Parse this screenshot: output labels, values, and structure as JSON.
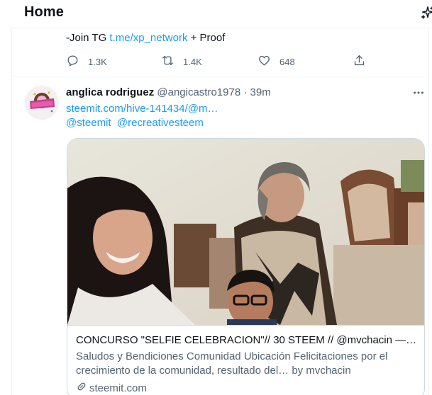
{
  "header": {
    "title": "Home",
    "sparkle_icon": "sparkle-icon"
  },
  "tweet1": {
    "text_prefix": "-Join TG ",
    "link": "t.me/xp_network",
    "text_suffix": " + Proof",
    "reply_count": "1.3K",
    "retweet_count": "1.4K",
    "like_count": "648"
  },
  "tweet2": {
    "display_name": "anglica rodriguez",
    "handle": "@angicastro1978",
    "separator": " · ",
    "time": "39m",
    "link": "steemit.com/hive-141434/@m…",
    "mention1": "@steemit",
    "mention2": "@recreativesteem",
    "card": {
      "title": "CONCURSO \"SELFIE CELEBRACION\"// 30 STEEM // @mvchacin — S…",
      "description": "Saludos y Bendiciones Comunidad Ubicación Felicitaciones por el crecimiento de la comunidad, resultado del… by mvchacin",
      "domain": "steemit.com"
    }
  },
  "colors": {
    "accent": "#1d9bf0",
    "muted": "#536471",
    "border": "#cfd9de"
  }
}
